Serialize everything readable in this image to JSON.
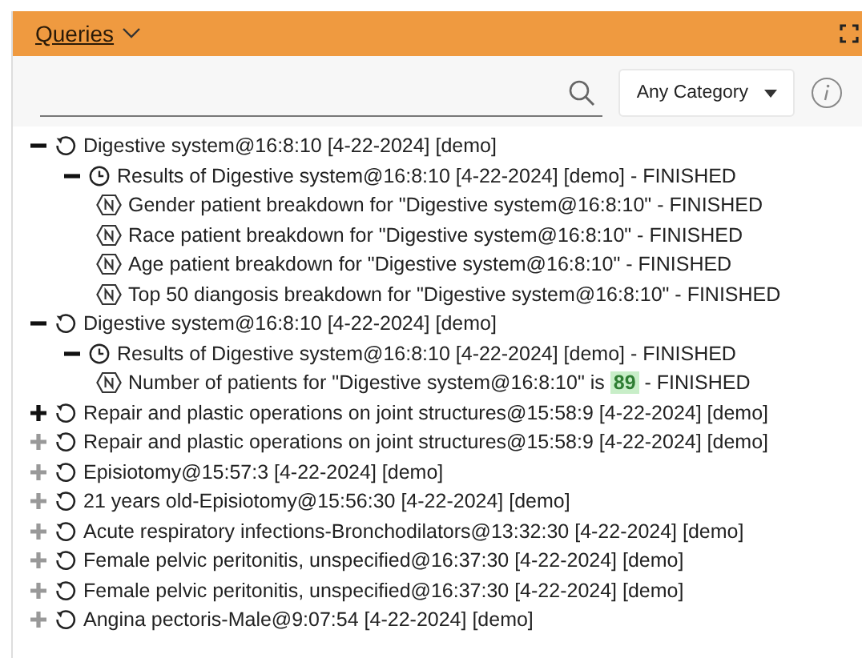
{
  "panel": {
    "title": "Queries"
  },
  "search": {
    "category": "Any Category"
  },
  "tree": [
    {
      "kind": "query",
      "label": "Digestive system@16:8:10 [4-22-2024] [demo]",
      "expanded": true,
      "highlighted": true,
      "children": [
        {
          "kind": "result",
          "label": "Results of Digestive system@16:8:10 [4-22-2024] [demo] - FINISHED",
          "expanded": true,
          "highlighted": true,
          "children": [
            {
              "kind": "stat",
              "label": "Gender patient breakdown for \"Digestive system@16:8:10\" - FINISHED"
            },
            {
              "kind": "stat",
              "label": "Race patient breakdown for \"Digestive system@16:8:10\" - FINISHED"
            },
            {
              "kind": "stat",
              "label": "Age patient breakdown for \"Digestive system@16:8:10\" - FINISHED"
            },
            {
              "kind": "stat",
              "label": "Top 50 diangosis breakdown for \"Digestive system@16:8:10\" - FINISHED"
            }
          ]
        }
      ]
    },
    {
      "kind": "query",
      "label": "Digestive system@16:8:10 [4-22-2024] [demo]",
      "expanded": true,
      "highlighted": true,
      "children": [
        {
          "kind": "result",
          "label": "Results of Digestive system@16:8:10 [4-22-2024] [demo] - FINISHED",
          "expanded": true,
          "highlighted": true,
          "children": [
            {
              "kind": "stat",
              "label": "Number of patients for \"Digestive system@16:8:10\" is",
              "value": "89",
              "suffix": "- FINISHED"
            }
          ]
        }
      ]
    },
    {
      "kind": "query",
      "label": "Repair and plastic operations on joint structures@15:58:9 [4-22-2024] [demo]",
      "expanded": false,
      "highlighted": true
    },
    {
      "kind": "query",
      "label": "Repair and plastic operations on joint structures@15:58:9 [4-22-2024] [demo]",
      "expanded": false,
      "highlighted": false
    },
    {
      "kind": "query",
      "label": "Episiotomy@15:57:3 [4-22-2024] [demo]",
      "expanded": false,
      "highlighted": false
    },
    {
      "kind": "query",
      "label": "21 years old-Episiotomy@15:56:30 [4-22-2024] [demo]",
      "expanded": false,
      "highlighted": false
    },
    {
      "kind": "query",
      "label": "Acute respiratory infections-Bronchodilators@13:32:30 [4-22-2024] [demo]",
      "expanded": false,
      "highlighted": false
    },
    {
      "kind": "query",
      "label": "Female pelvic peritonitis, unspecified@16:37:30 [4-22-2024] [demo]",
      "expanded": false,
      "highlighted": false
    },
    {
      "kind": "query",
      "label": "Female pelvic peritonitis, unspecified@16:37:30 [4-22-2024] [demo]",
      "expanded": false,
      "highlighted": false
    },
    {
      "kind": "query",
      "label": "Angina pectoris-Male@9:07:54 [4-22-2024] [demo]",
      "expanded": false,
      "highlighted": false
    }
  ]
}
